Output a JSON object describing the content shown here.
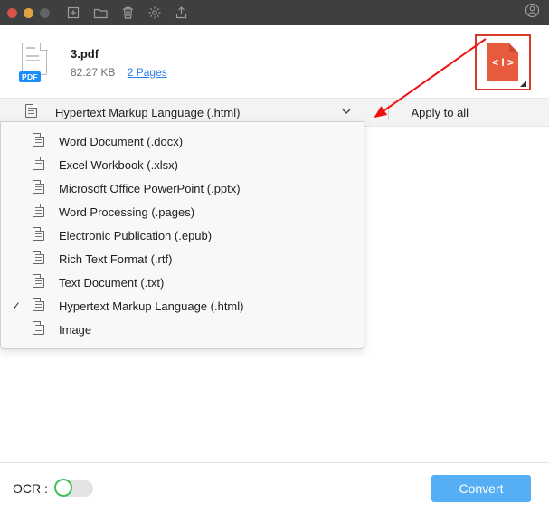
{
  "file": {
    "badge": "PDF",
    "name": "3.pdf",
    "size": "82.27 KB",
    "pages_label": "2 Pages"
  },
  "format_bar": {
    "selected": "Hypertext Markup Language (.html)",
    "apply_all": "Apply to all"
  },
  "dropdown": {
    "items": [
      {
        "label": "Word Document (.docx)",
        "checked": false
      },
      {
        "label": "Excel Workbook (.xlsx)",
        "checked": false
      },
      {
        "label": "Microsoft Office PowerPoint (.pptx)",
        "checked": false
      },
      {
        "label": "Word Processing (.pages)",
        "checked": false
      },
      {
        "label": "Electronic Publication (.epub)",
        "checked": false
      },
      {
        "label": "Rich Text Format (.rtf)",
        "checked": false
      },
      {
        "label": "Text Document (.txt)",
        "checked": false
      },
      {
        "label": "Hypertext Markup Language (.html)",
        "checked": true
      },
      {
        "label": "Image",
        "checked": false
      }
    ]
  },
  "output_tile": {
    "glyph": "< I >"
  },
  "bottom": {
    "ocr_label": "OCR :",
    "ocr_on": false,
    "convert_label": "Convert"
  },
  "colors": {
    "accent_orange": "#e75b3c",
    "accent_blue": "#56aef4",
    "link_blue": "#2b7ce6",
    "highlight_red": "#d63b29"
  }
}
